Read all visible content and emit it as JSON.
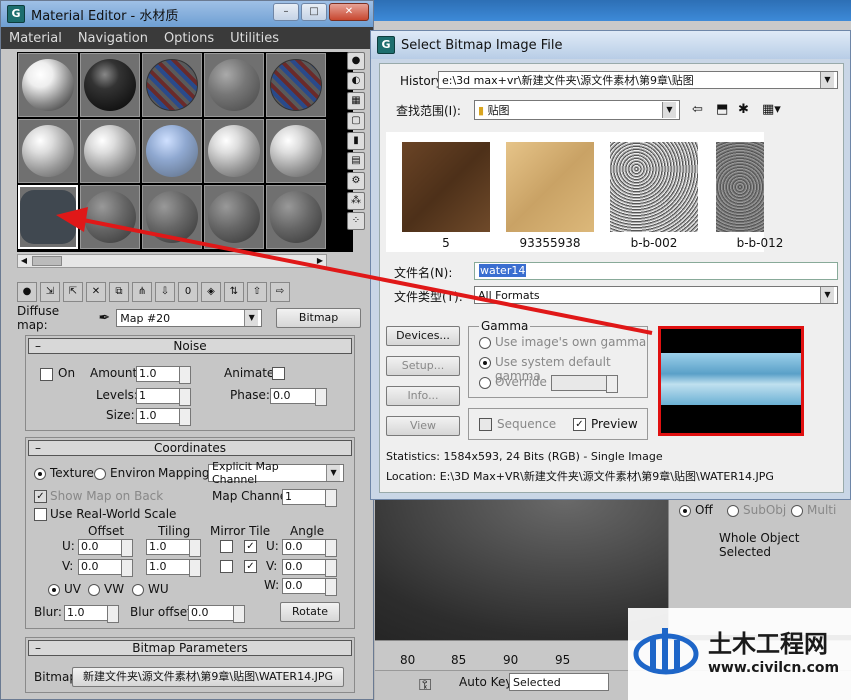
{
  "material_editor": {
    "title": "Material Editor - 水材质",
    "menu": [
      "Material",
      "Navigation",
      "Options",
      "Utilities"
    ],
    "diffuse_map_label": "Diffuse map:",
    "diffuse_map_value": "Map #20",
    "bitmap_button": "Bitmap",
    "noise": {
      "header": "Noise",
      "on_label": "On",
      "amount_label": "Amount:",
      "amount_value": "1.0",
      "animate_label": "Animate:",
      "levels_label": "Levels:",
      "levels_value": "1",
      "phase_label": "Phase:",
      "phase_value": "0.0",
      "size_label": "Size:",
      "size_value": "1.0"
    },
    "coordinates": {
      "header": "Coordinates",
      "texture_label": "Texture",
      "environ_label": "Environ",
      "mapping_label": "Mapping:",
      "mapping_value": "Explicit Map Channel",
      "show_map_on_back": "Show Map on Back",
      "map_channel_label": "Map Channel:",
      "map_channel_value": "1",
      "real_world_scale": "Use Real-World Scale",
      "offset_label": "Offset",
      "tiling_label": "Tiling",
      "mirror_tile_label": "Mirror Tile",
      "angle_label": "Angle",
      "u_label": "U:",
      "v_label": "V:",
      "w_label": "W:",
      "offset_u": "0.0",
      "offset_v": "0.0",
      "tiling_u": "1.0",
      "tiling_v": "1.0",
      "angle_u": "0.0",
      "angle_v": "0.0",
      "angle_w": "0.0",
      "uv_label": "UV",
      "vw_label": "VW",
      "wu_label": "WU",
      "blur_label": "Blur:",
      "blur_value": "1.0",
      "blur_offset_label": "Blur offset:",
      "blur_offset_value": "0.0",
      "rotate_button": "Rotate"
    },
    "bitmap_params": {
      "header": "Bitmap Parameters",
      "bitmap_label": "Bitmap:",
      "bitmap_path": "新建文件夹\\源文件素材\\第9章\\贴图\\WATER14.JPG"
    }
  },
  "dialog": {
    "title": "Select Bitmap Image File",
    "history_label": "History:",
    "history_value": "e:\\3d max+vr\\新建文件夹\\源文件素材\\第9章\\贴图",
    "lookin_label": "查找范围(I):",
    "lookin_value": "贴图",
    "thumbnails": [
      "5",
      "93355938",
      "b-b-002",
      "b-b-012"
    ],
    "filename_label": "文件名(N):",
    "filename_value": "water14",
    "filetype_label": "文件类型(T):",
    "filetype_value": "All Formats",
    "buttons": {
      "devices": "Devices...",
      "setup": "Setup...",
      "info": "Info...",
      "view": "View"
    },
    "gamma": {
      "title": "Gamma",
      "own": "Use image's own gamma",
      "system": "Use system default gamma",
      "override": "Override"
    },
    "sequence_label": "Sequence",
    "preview_label": "Preview",
    "statistics": "Statistics:  1584x593, 24 Bits (RGB) - Single Image",
    "location": "Location:  E:\\3D Max+VR\\新建文件夹\\源文件素材\\第9章\\贴图\\WATER14.JPG"
  },
  "background": {
    "off_label": "Off",
    "subobj_label": "SubObj",
    "multi_label": "Multi",
    "whole_object": "Whole Object Selected",
    "ticks": [
      "80",
      "85",
      "90",
      "95"
    ],
    "auto_key": "Auto Key",
    "selected": "Selected"
  },
  "watermark": {
    "name": "土木工程网",
    "url": "www.civilcn.com"
  },
  "colors": {
    "arrow": "#e01818",
    "highlight": "#e01010"
  }
}
